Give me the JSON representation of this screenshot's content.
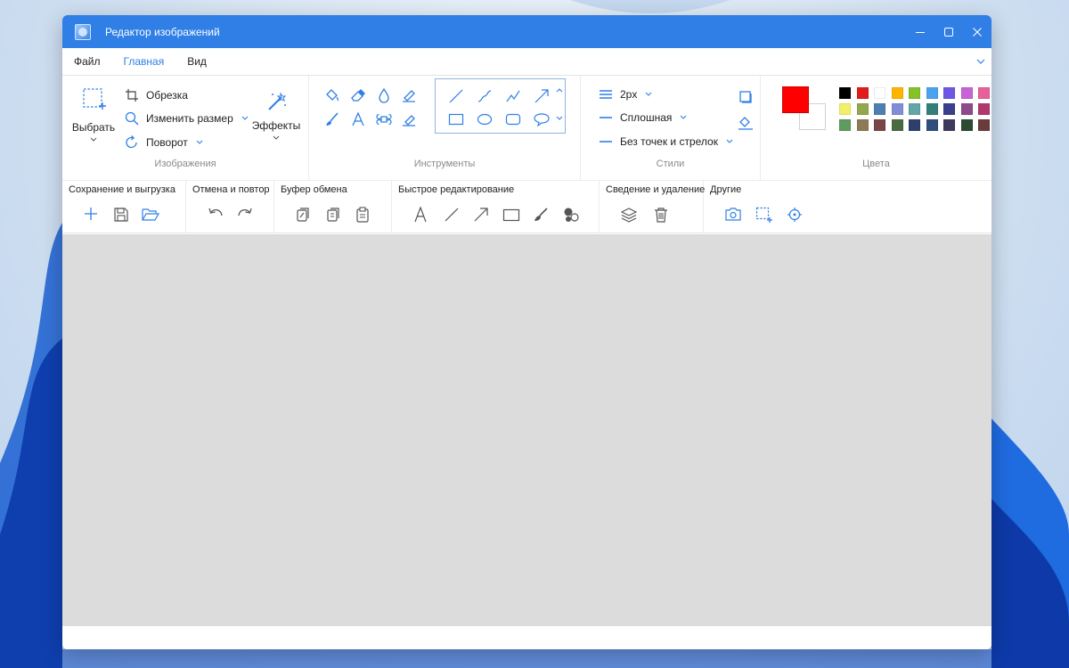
{
  "window": {
    "title": "Редактор изображений"
  },
  "menu": {
    "tabs": [
      "Файл",
      "Главная",
      "Вид"
    ]
  },
  "ribbon": {
    "images": {
      "label": "Изображения",
      "select_label": "Выбрать",
      "crop_label": "Обрезка",
      "resize_label": "Изменить размер",
      "rotate_label": "Поворот",
      "effects_label": "Эффекты"
    },
    "tools": {
      "label": "Инструменты"
    },
    "styles": {
      "label": "Стили",
      "thickness": "2px",
      "line_style": "Сплошная",
      "arrows": "Без точек и стрелок"
    },
    "colors": {
      "label": "Цвета",
      "primary": "#ff0000",
      "secondary": "#ffffff",
      "palette_row1": [
        "#000000",
        "#e21b1b",
        "#ffffff",
        "#ffb400",
        "#84c225",
        "#4aa3ef",
        "#6d58e6",
        "#c763d6",
        "#e8609a",
        "#f07662"
      ],
      "palette_row2": [
        "#f4ef6a",
        "#93a84d",
        "#4d7fb2",
        "#7f8ed6",
        "#61a7a8",
        "#347f7a",
        "#3b3f8e",
        "#8e4a8a",
        "#b0386e",
        "#e06a6a"
      ],
      "palette_row3": [
        "#5f9a5f",
        "#8e7a55",
        "#7a4646",
        "#4a6a40",
        "#2f3f6c",
        "#2e4f7c",
        "#3e3b5e",
        "#2d4a33",
        "#6b3b3b",
        "#2a9c99"
      ]
    }
  },
  "quickbar": {
    "save_group": "Сохранение и выгрузка",
    "undo_group": "Отмена и повтор",
    "clipboard_group": "Буфер обмена",
    "quick_edit_group": "Быстрое редактирование",
    "merge_group": "Сведение и удаление",
    "other_group": "Другие"
  },
  "accent": "#2f7fe6"
}
